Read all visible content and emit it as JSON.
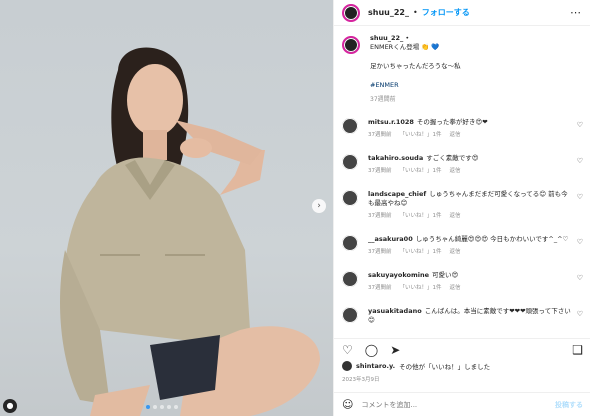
{
  "post": {
    "username": "shuu_22_",
    "separator": "•",
    "follow_label": "フォローする",
    "more_icon": "⋯"
  },
  "caption": {
    "username": "shuu_22_",
    "dot": "•",
    "line1": "ENMERくん登場 👏 💙",
    "line2": "足かいちゃったんだろうな～私",
    "hashtag": "#ENMER",
    "time": "37週間前"
  },
  "comments": [
    {
      "user": "mitsu.r.1028",
      "text": "その握った拳が好き😍❤",
      "time": "37週間前",
      "likes": "「いいね！」1件",
      "reply": "返信"
    },
    {
      "user": "takahiro.souda",
      "text": "すごく素敵です😍",
      "time": "37週間前",
      "likes": "「いいね！」1件",
      "reply": "返信"
    },
    {
      "user": "landscape_chief",
      "text": "しゅうちゃんまだまだ可愛くなってる😊 前も今も最高やね😊",
      "time": "37週間前",
      "likes": "「いいね！」1件",
      "reply": "返信"
    },
    {
      "user": "__asakura00",
      "text": "しゅうちゃん綺麗😍😍😍 今日もかわいいです^_^♡",
      "time": "37週間前",
      "likes": "「いいね！」1件",
      "reply": "返信"
    },
    {
      "user": "sakuyayokomine",
      "text": "可愛い😍",
      "time": "37週間前",
      "likes": "「いいね！」1件",
      "reply": "返信"
    },
    {
      "user": "yasuakitadano",
      "text": "こんばんは。本当に素敵です❤❤❤頑張って下さい😊",
      "time": "",
      "likes": "",
      "reply": ""
    }
  ],
  "likes_line": {
    "user": "shintaro.y.",
    "suffix": "その他が「いいね！」しました"
  },
  "date": "2023年3月9日",
  "add_comment": {
    "placeholder": "コメントを追加...",
    "post_label": "投稿する"
  },
  "carousel": {
    "active_index": 0,
    "count": 5
  }
}
